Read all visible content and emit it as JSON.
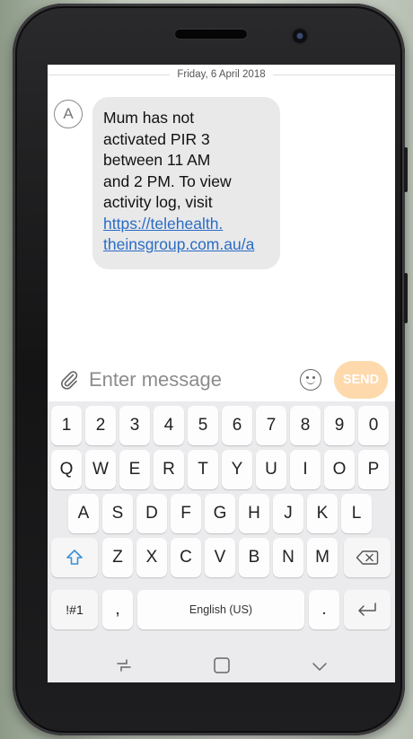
{
  "conversation": {
    "date_separator": "Friday, 6 April 2018",
    "sender_initial": "A",
    "message_lines": [
      "Mum has not",
      "activated PIR 3",
      "between 11 AM",
      "and 2 PM. To view",
      "activity log, visit"
    ],
    "message_link_lines": [
      "https://telehealth.",
      "theinsgroup.com.au/a"
    ]
  },
  "composer": {
    "placeholder": "Enter message",
    "send_label": "SEND"
  },
  "keyboard": {
    "row_numbers": [
      "1",
      "2",
      "3",
      "4",
      "5",
      "6",
      "7",
      "8",
      "9",
      "0"
    ],
    "row_top": [
      "Q",
      "W",
      "E",
      "R",
      "T",
      "Y",
      "U",
      "I",
      "O",
      "P"
    ],
    "row_middle": [
      "A",
      "S",
      "D",
      "F",
      "G",
      "H",
      "J",
      "K",
      "L"
    ],
    "row_bottom": [
      "Z",
      "X",
      "C",
      "V",
      "B",
      "N",
      "M"
    ],
    "symbols_label": "!#1",
    "comma_label": ",",
    "space_label": "English (US)",
    "period_label": "."
  },
  "colors": {
    "send_button": "#fdd9ac",
    "link": "#2a6cc4",
    "bubble": "#e9e9ea"
  },
  "icons": {
    "attach": "paperclip-icon",
    "emoji": "smiley-icon",
    "shift": "shift-arrow-icon",
    "backspace": "backspace-icon",
    "enter": "enter-icon",
    "nav_recent": "recent-apps-icon",
    "nav_home": "home-icon",
    "nav_back": "back-icon"
  }
}
